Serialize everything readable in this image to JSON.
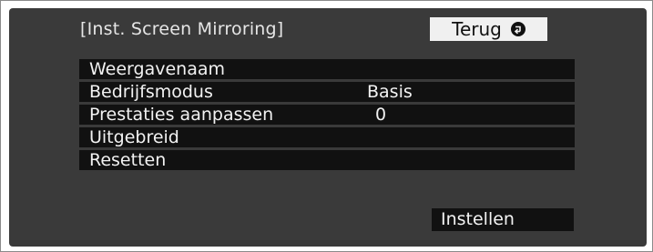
{
  "dialog": {
    "title": "[Inst. Screen Mirroring]",
    "back_label": "Terug",
    "back_icon": "circle-arrow-icon"
  },
  "menu": {
    "items": [
      {
        "label": "Weergavenaam",
        "value": ""
      },
      {
        "label": "Bedrijfsmodus",
        "value": "Basis"
      },
      {
        "label": "Prestaties aanpassen",
        "value": "0"
      },
      {
        "label": "Uitgebreid",
        "value": ""
      },
      {
        "label": "Resetten",
        "value": ""
      }
    ]
  },
  "footer": {
    "set_label": "Instellen"
  },
  "colors": {
    "panel_bg": "#3a3a3a",
    "row_bg": "#111111",
    "button_bg": "#f0f0f0",
    "text": "#f2f2f2"
  }
}
